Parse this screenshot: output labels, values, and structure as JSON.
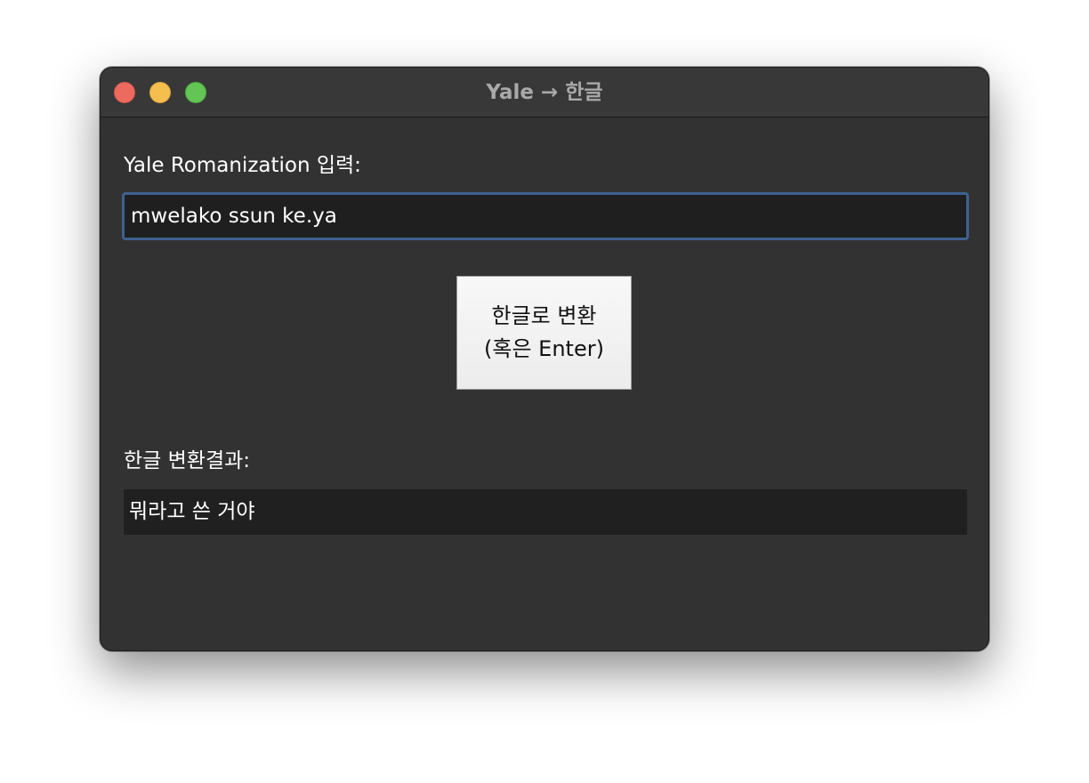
{
  "window": {
    "title": "Yale → 한글"
  },
  "input": {
    "label": "Yale Romanization 입력:",
    "value": "mwelako ssun ke.ya"
  },
  "convert_button": {
    "line1": "한글로 변환",
    "line2": "(혹은 Enter)"
  },
  "result": {
    "label": "한글 변환결과:",
    "value": "뭐라고 쓴 거야"
  },
  "colors": {
    "close": "#ed6a5e",
    "minimize": "#f5bf4f",
    "maximize": "#62c554",
    "focus_ring": "#3f6190",
    "window_bg": "#323232"
  }
}
